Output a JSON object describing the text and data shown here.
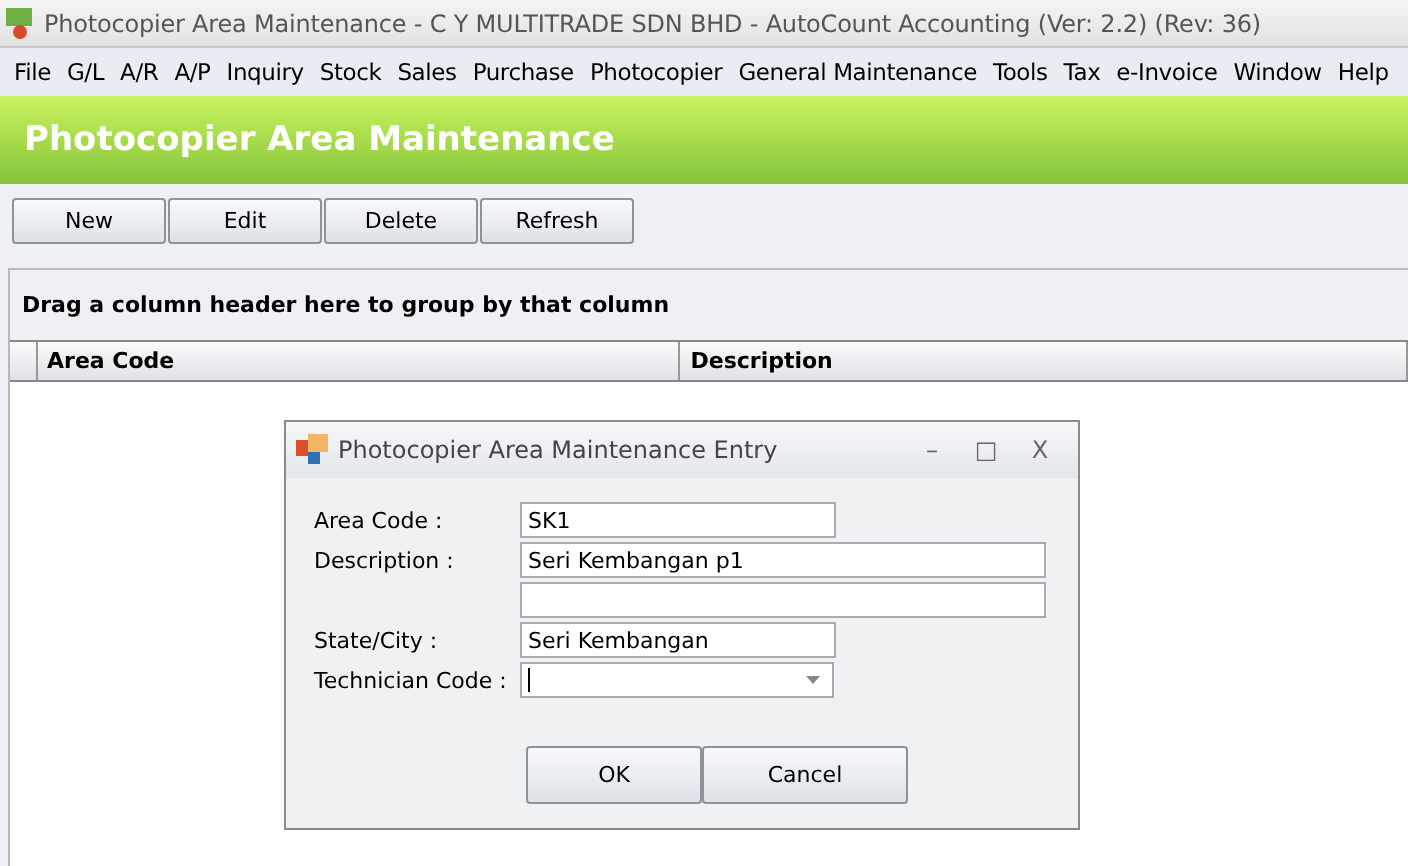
{
  "window": {
    "title": "Photocopier Area Maintenance - C Y MULTITRADE SDN BHD - AutoCount Accounting (Ver: 2.2) (Rev: 36)"
  },
  "menu": [
    "File",
    "G/L",
    "A/R",
    "A/P",
    "Inquiry",
    "Stock",
    "Sales",
    "Purchase",
    "Photocopier",
    "General Maintenance",
    "Tools",
    "Tax",
    "e-Invoice",
    "Window",
    "Help"
  ],
  "header": {
    "title": "Photocopier Area Maintenance"
  },
  "toolbar": [
    "New",
    "Edit",
    "Delete",
    "Refresh"
  ],
  "grid": {
    "group_hint": "Drag a column header here to group by that column",
    "columns": [
      "Area Code",
      "Description"
    ]
  },
  "dialog": {
    "title": "Photocopier Area Maintenance Entry",
    "controls": [
      "–",
      "□",
      "X"
    ],
    "fields": [
      {
        "label": "Area Code :",
        "value": "SK1",
        "kind": "short"
      },
      {
        "label": "Description :",
        "value": "Seri Kembangan p1",
        "kind": "long"
      },
      {
        "kind": "long"
      },
      {
        "label": "State/City :",
        "value": "Seri Kembangan",
        "kind": "short"
      },
      {
        "label": "Technician Code :",
        "kind": "combo"
      }
    ],
    "buttons": [
      "OK",
      "Cancel"
    ]
  }
}
